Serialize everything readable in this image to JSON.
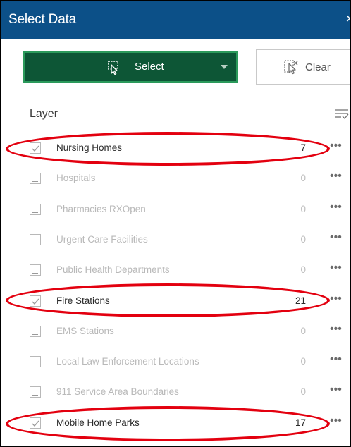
{
  "panel": {
    "title": "Select Data",
    "close_glyph": "×"
  },
  "toolbar": {
    "select_label": "Select",
    "clear_label": "Clear",
    "select_icon": "select-by-rectangle-icon",
    "clear_icon": "clear-selection-icon"
  },
  "layers": {
    "header": "Layer",
    "filter_icon": "filter-lines-icon",
    "items": [
      {
        "name": "Nursing Homes",
        "count": "7",
        "checked": true
      },
      {
        "name": "Hospitals",
        "count": "0",
        "checked": false
      },
      {
        "name": "Pharmacies RXOpen",
        "count": "0",
        "checked": false
      },
      {
        "name": "Urgent Care Facilities",
        "count": "0",
        "checked": false
      },
      {
        "name": "Public Health Departments",
        "count": "0",
        "checked": false
      },
      {
        "name": "Fire Stations",
        "count": "21",
        "checked": true
      },
      {
        "name": "EMS Stations",
        "count": "0",
        "checked": false
      },
      {
        "name": "Local Law Enforcement Locations",
        "count": "0",
        "checked": false
      },
      {
        "name": "911 Service Area Boundaries",
        "count": "0",
        "checked": false
      },
      {
        "name": "Mobile Home Parks",
        "count": "17",
        "checked": true
      }
    ],
    "more_glyph": "•••"
  },
  "colors": {
    "title_bar": "#0c5088",
    "select_button": "#0d5636",
    "select_border": "#2b9a5b",
    "annotation": "#e3000f"
  }
}
